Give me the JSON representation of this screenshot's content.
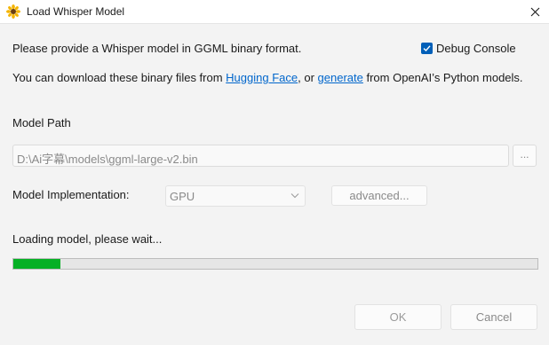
{
  "window": {
    "title": "Load Whisper Model",
    "app_icon": "sunflower-icon",
    "close_icon": "close-icon"
  },
  "intro": {
    "text": "Please provide a Whisper model in GGML binary format.",
    "debug_console": {
      "label": "Debug Console",
      "checked": true
    }
  },
  "download": {
    "prefix": "You can download these binary files from ",
    "link1": "Hugging Face",
    "middle": ", or ",
    "link2": "generate",
    "suffix": " from OpenAI’s Python models."
  },
  "model_path": {
    "label": "Model Path",
    "value": "D:\\Ai字幕\\models\\ggml-large-v2.bin",
    "browse_label": "..."
  },
  "implementation": {
    "label": "Model Implementation:",
    "selected": "GPU",
    "advanced_label": "advanced..."
  },
  "status": {
    "text": "Loading model, please wait...",
    "progress": 0.09
  },
  "buttons": {
    "ok": "OK",
    "cancel": "Cancel"
  },
  "colors": {
    "accent": "#005fb8",
    "link": "#0066cc",
    "progress_fill": "#06b025"
  }
}
